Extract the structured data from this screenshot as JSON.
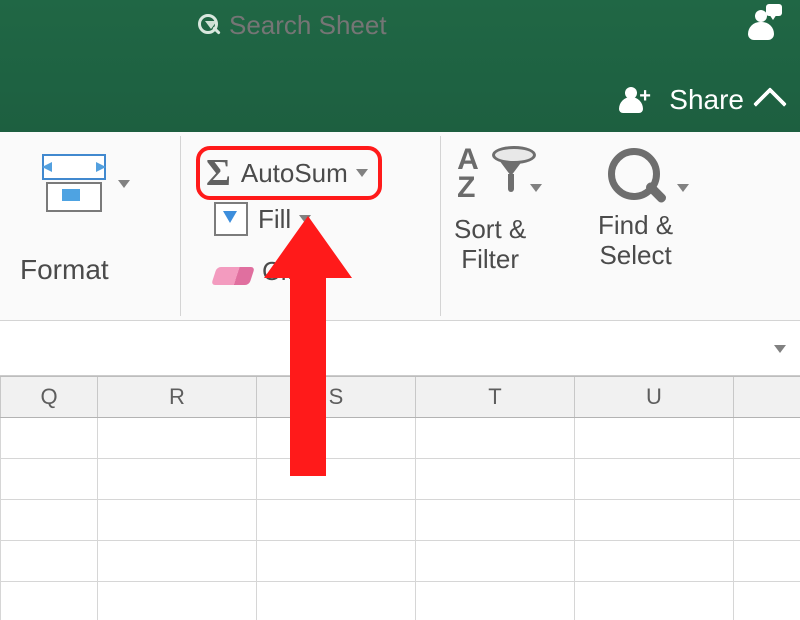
{
  "titlebar": {
    "search_placeholder": "Search Sheet",
    "share_label": "Share"
  },
  "ribbon": {
    "format_label": "Format",
    "autosum_label": "AutoSum",
    "fill_label": "Fill",
    "clear_label": "Clear",
    "sort_label": "Sort &\nFilter",
    "find_label": "Find &\nSelect"
  },
  "columns": [
    "Q",
    "R",
    "S",
    "T",
    "U"
  ],
  "rows": 5
}
